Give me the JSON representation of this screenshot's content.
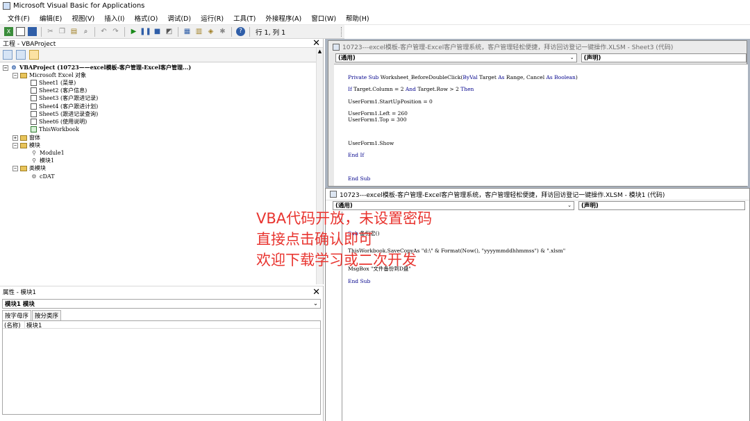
{
  "window": {
    "title": "Microsoft Visual Basic for Applications"
  },
  "menu": [
    "文件(F)",
    "编辑(E)",
    "视图(V)",
    "插入(I)",
    "格式(O)",
    "调试(D)",
    "运行(R)",
    "工具(T)",
    "外接程序(A)",
    "窗口(W)",
    "帮助(H)"
  ],
  "toolbar": {
    "position": "行 1, 列 1"
  },
  "project": {
    "title": "工程 - VBAProject",
    "close": "✕",
    "root": "VBAProject (10723——excel模板-客户管理-Excel客户管理...)",
    "excel_objects": "Microsoft Excel 对象",
    "sheets": [
      "Sheet1 (菜单)",
      "Sheet2 (客户信息)",
      "Sheet3 (客户跟进记录)",
      "Sheet4 (客户跟进计划)",
      "Sheet5 (跟进记录查询)",
      "Sheet6 (使用说明)"
    ],
    "thisworkbook": "ThisWorkbook",
    "forms": "窗体",
    "modules": "模块",
    "module_items": [
      "Module1",
      "模块1"
    ],
    "class_modules": "类模块",
    "class_items": [
      "cDAT"
    ]
  },
  "properties": {
    "title": "属性 - 模块1",
    "close": "✕",
    "object": "模块1 模块",
    "tabs": [
      "按字母序",
      "按分类序"
    ],
    "rows": [
      {
        "key": "(名称)",
        "value": "模块1"
      }
    ]
  },
  "code_window_1": {
    "title": "10723---excel模板-客户管理-Excel客户管理系统，客户管理轻松便捷，拜访回访登记一键操作.XLSM - Sheet3 (代码)",
    "object_combo": "(通用)",
    "proc_combo": "(声明)",
    "lines": [
      "Private Sub Worksheet_BeforeDoubleClick(ByVal Target As Range, Cancel As Boolean)",
      "If Target.Column = 2 And Target.Row > 2 Then",
      "UserForm1.StartUpPosition = 0",
      "UserForm1.Left = 260",
      "UserForm1.Top = 300",
      "UserForm1.Show",
      "End If",
      "End Sub"
    ]
  },
  "code_window_2": {
    "title": "10723---excel模板-客户管理-Excel客户管理系统，客户管理轻松便捷，拜访回访登记一键操作.XLSM - 模块1 (代码)",
    "object_combo": "(通用)",
    "proc_combo": "(声明)",
    "lines": [
      "Sub 备份宏()",
      "ThisWorkbook.SaveCopyAs \"d:\\\" & Format(Now(), \"yyyymmddhhmmss\") & \".xlsm\"",
      "MsgBox \"文件备份到D盘\"",
      "End Sub"
    ]
  },
  "overlay": {
    "lines": [
      "VBA代码开放，未设置密码",
      "直接点击确认即可",
      "欢迎下载学习或二次开发"
    ],
    "color": "#e8342f"
  }
}
